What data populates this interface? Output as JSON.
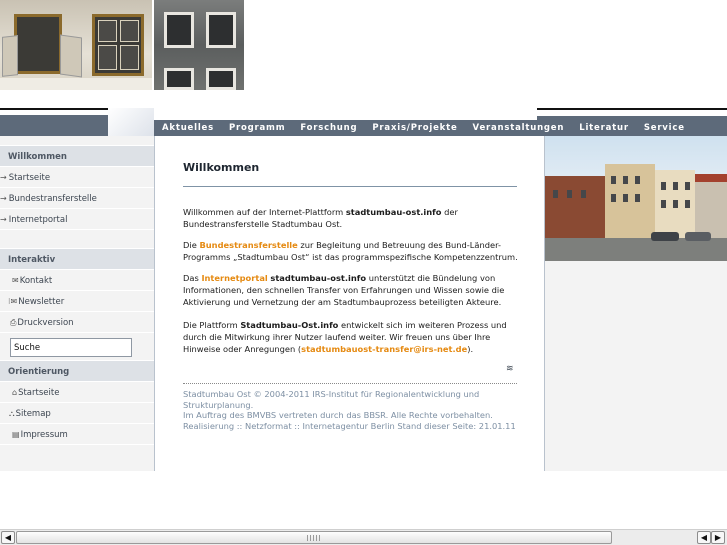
{
  "nav": {
    "items": [
      "Aktuelles",
      "Programm",
      "Forschung",
      "Praxis/Projekte",
      "Veranstaltungen",
      "Literatur",
      "Service"
    ]
  },
  "sidebar": {
    "section1": {
      "title": "Willkommen",
      "items": [
        "Startseite",
        "Bundestransferstelle",
        "Internetportal"
      ]
    },
    "section2": {
      "title": "Interaktiv",
      "items": [
        "Kontakt",
        "Newsletter",
        "Druckversion"
      ]
    },
    "search": {
      "value": "Suche"
    },
    "section3": {
      "title": "Orientierung",
      "items": [
        "Startseite",
        "Sitemap",
        "Impressum"
      ]
    }
  },
  "main": {
    "title": "Willkommen",
    "p1": {
      "a": "Willkommen auf der Internet-Plattform ",
      "b": "stadtumbau-ost.info",
      "c": " der Bundestransferstelle Stadtumbau Ost."
    },
    "p2": {
      "a": "Die ",
      "link": "Bundestransferstelle",
      "b": " zur Begleitung und Betreuung des Bund-Länder-Programms „Stadtumbau Ost“ ist das programmspezifische Kompetenzzentrum."
    },
    "p3": {
      "a": "Das ",
      "link": "Internetportal",
      "b": " ",
      "bold": "stadtumbau-ost.info",
      "c": " unterstützt die Bündelung von Informationen, den schnellen Transfer von Erfahrungen und Wissen sowie die Aktivierung und Vernetzung der am Stadtumbauprozess beteiligten Akteure."
    },
    "p4": {
      "a": "Die Plattform ",
      "bold": "Stadtumbau-Ost.info",
      "b": " entwickelt sich im weiteren Prozess und durch die Mitwirkung ihrer Nutzer laufend weiter. Wir freuen uns über Ihre Hinweise oder Anregungen (",
      "email": "stadtumbauost-transfer@irs-net.de",
      "c": ")."
    },
    "footer": {
      "line1": "Stadtumbau Ost © 2004-2011 IRS-Institut für Regionalentwicklung und Strukturplanung.",
      "line2a": "Im Auftrag des ",
      "bmvbs": "BMVBS",
      "line2b": " vertreten durch das ",
      "bbsr": "BBSR",
      "line2c": ". Alle Rechte vorbehalten.",
      "line3a": "Realisierung :: ",
      "netzformat": "Netzformat",
      "line3b": " :: ",
      "agentur": "Internetagentur Berlin",
      "line3c": " Stand dieser Seite: 21.01.11"
    }
  },
  "colors": {
    "nav_bar": "#5d6a7a",
    "link_orange": "#e58a12",
    "footer_text": "#7d8fa3",
    "sidebar_head_bg": "#dde1e6"
  },
  "icons": {
    "sidebar_arrow": "arrow-right-icon",
    "kontakt": "envelope-icon",
    "newsletter": "newsletter-icon",
    "druckversion": "printer-icon",
    "startseite": "home-icon",
    "sitemap": "sitemap-icon",
    "impressum": "document-icon",
    "page_top": "page-top-icon"
  }
}
